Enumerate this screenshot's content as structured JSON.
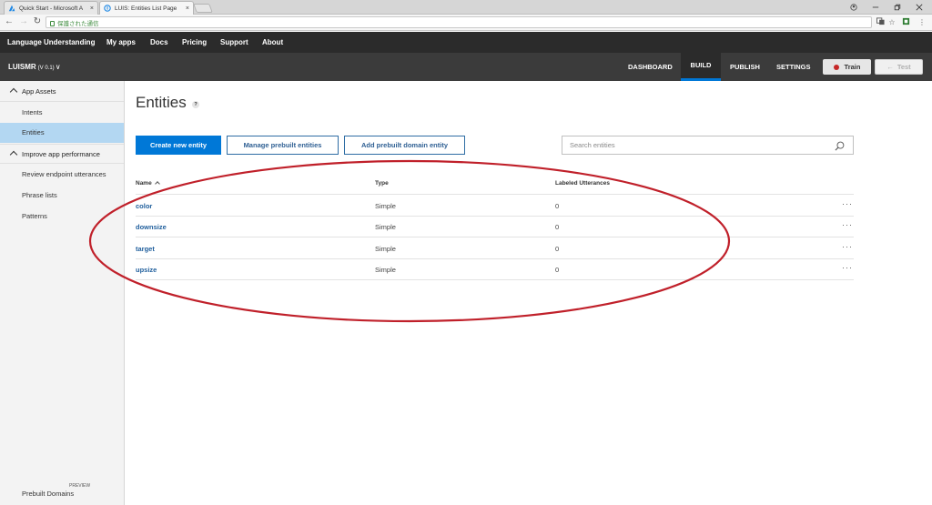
{
  "browser": {
    "tabs": [
      {
        "label": "Quick Start - Microsoft A",
        "close": "×"
      },
      {
        "label": "LUIS: Entities List Page",
        "close": "×"
      }
    ],
    "address": "保護された通信"
  },
  "topnav": [
    "Language Understanding",
    "My apps",
    "Docs",
    "Pricing",
    "Support",
    "About"
  ],
  "app": {
    "name": "LUISMR",
    "version": "(V 0.1)",
    "chevron": "∨",
    "nav": [
      "DASHBOARD",
      "BUILD",
      "PUBLISH",
      "SETTINGS"
    ],
    "active_nav": "BUILD",
    "train_label": "Train",
    "test_label": "Test"
  },
  "sidebar": {
    "group1": "App Assets",
    "group1_items": [
      "Intents",
      "Entities"
    ],
    "group2": "Improve app performance",
    "group2_items": [
      "Review endpoint utterances",
      "Phrase lists",
      "Patterns"
    ],
    "active_item": "Entities",
    "footer": "Prebuilt Domains",
    "footer_tag": "PREVIEW"
  },
  "main": {
    "title": "Entities",
    "help": "?",
    "buttons": {
      "create": "Create new entity",
      "manage": "Manage prebuilt entities",
      "add_domain": "Add prebuilt domain entity"
    },
    "search_placeholder": "Search entities",
    "columns": {
      "name": "Name",
      "type": "Type",
      "labeled": "Labeled Utterances"
    },
    "rows": [
      {
        "name": "color",
        "type": "Simple",
        "labeled": "0",
        "more": "···"
      },
      {
        "name": "downsize",
        "type": "Simple",
        "labeled": "0",
        "more": "···"
      },
      {
        "name": "target",
        "type": "Simple",
        "labeled": "0",
        "more": "···"
      },
      {
        "name": "upsize",
        "type": "Simple",
        "labeled": "0",
        "more": "···"
      }
    ]
  },
  "colors": {
    "accent": "#0078d7",
    "topnav_bg": "#2b2b2b",
    "header_bg": "#3b3b3b",
    "sidebar_active": "#b3d7f2",
    "annotation_oval": "#c0202a",
    "record_dot": "#c62828"
  }
}
